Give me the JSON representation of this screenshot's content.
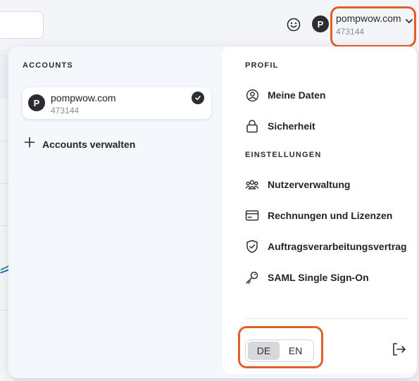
{
  "header": {
    "user_name": "pompwow.com",
    "user_id": "473144",
    "avatar_letter": "P"
  },
  "accounts": {
    "section_label": "ACCOUNTS",
    "items": [
      {
        "avatar_letter": "P",
        "name": "pompwow.com",
        "id": "473144",
        "selected": true
      }
    ],
    "manage_label": "Accounts verwalten"
  },
  "profile": {
    "section_label": "PROFIL",
    "items": [
      {
        "label": "Meine Daten",
        "icon": "user-circle-icon"
      },
      {
        "label": "Sicherheit",
        "icon": "lock-icon"
      }
    ]
  },
  "settings": {
    "section_label": "EINSTELLUNGEN",
    "items": [
      {
        "label": "Nutzerverwaltung",
        "icon": "users-icon"
      },
      {
        "label": "Rechnungen und Lizenzen",
        "icon": "credit-card-icon"
      },
      {
        "label": "Auftragsverarbeitungsvertrag",
        "icon": "shield-check-icon"
      },
      {
        "label": "SAML Single Sign-On",
        "icon": "key-icon"
      }
    ]
  },
  "language": {
    "options": [
      "DE",
      "EN"
    ],
    "selected": "DE"
  },
  "colors": {
    "highlight": "#e0602a",
    "avatar_bg": "#2c2d31",
    "panel_bg": "#f4f7fb"
  }
}
